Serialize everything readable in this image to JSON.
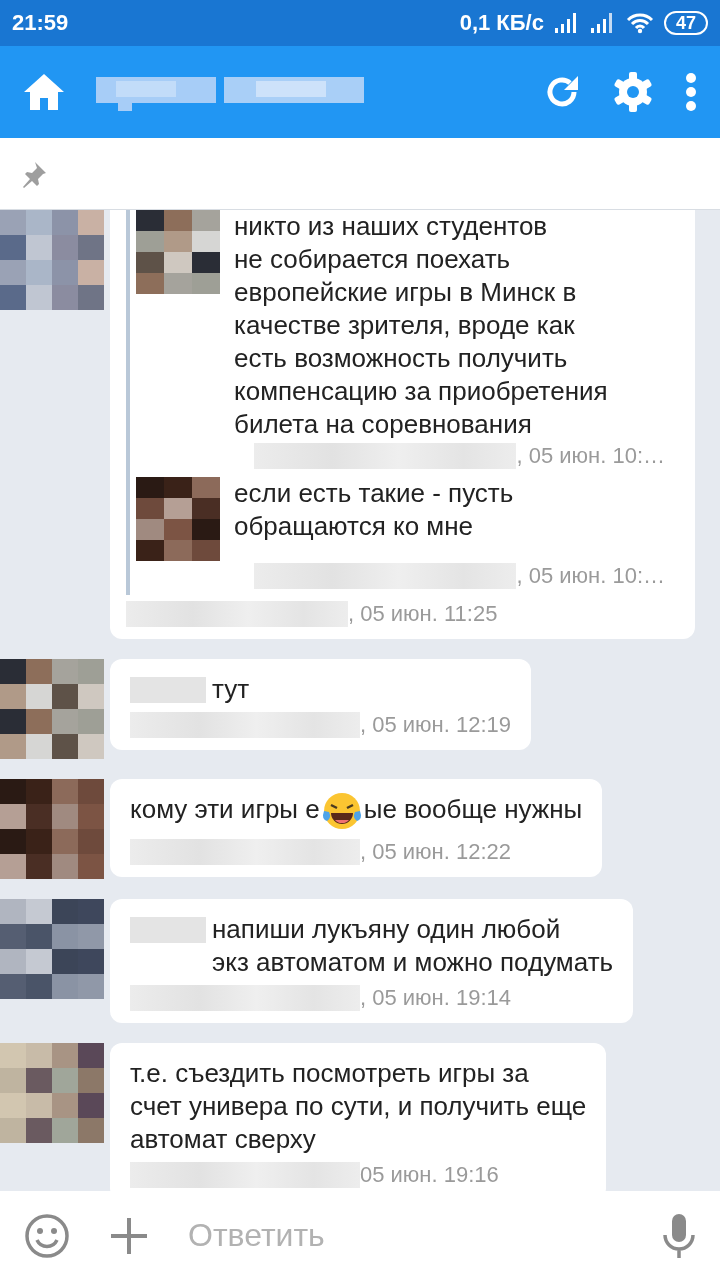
{
  "status_bar": {
    "time": "21:59",
    "net_speed": "0,1 КБ/с",
    "battery": "47"
  },
  "messages": [
    {
      "kind": "forward",
      "quotes": [
        {
          "text": "никто из наших студентов\nне собирается поехать\nевропейские игры в Минск в\nкачестве зрителя, вроде как\nесть возможность получить\nкомпенсацию за приобретения\nбилета на соревнования",
          "time": ", 05 июн. 10:…"
        },
        {
          "text": "если есть такие - пусть\nобращаются ко мне",
          "time": ", 05 июн. 10:…"
        }
      ],
      "time": ", 05 июн. 11:25"
    },
    {
      "kind": "text",
      "mention": true,
      "segments": [
        {
          "kind": "text",
          "text": "тут"
        }
      ],
      "time": ", 05 июн. 12:19"
    },
    {
      "kind": "text",
      "mention": false,
      "segments": [
        {
          "kind": "text",
          "text": "кому эти игры е"
        },
        {
          "kind": "emoji"
        },
        {
          "kind": "text",
          "text": "ые вообще нужны"
        }
      ],
      "time": ", 05 июн. 12:22"
    },
    {
      "kind": "text",
      "mention": true,
      "segments": [
        {
          "kind": "text",
          "text": "напиши лукъяну один любой\nэкз автоматом и можно подумать"
        }
      ],
      "time": ", 05 июн. 19:14"
    },
    {
      "kind": "text",
      "mention": false,
      "segments": [
        {
          "kind": "text",
          "text": "т.е. съездить посмотреть игры за\nсчет универа по сути, и получить еще\nавтомат сверху"
        }
      ],
      "time": "05 июн. 19:16"
    }
  ],
  "composer": {
    "placeholder": "Ответить"
  }
}
